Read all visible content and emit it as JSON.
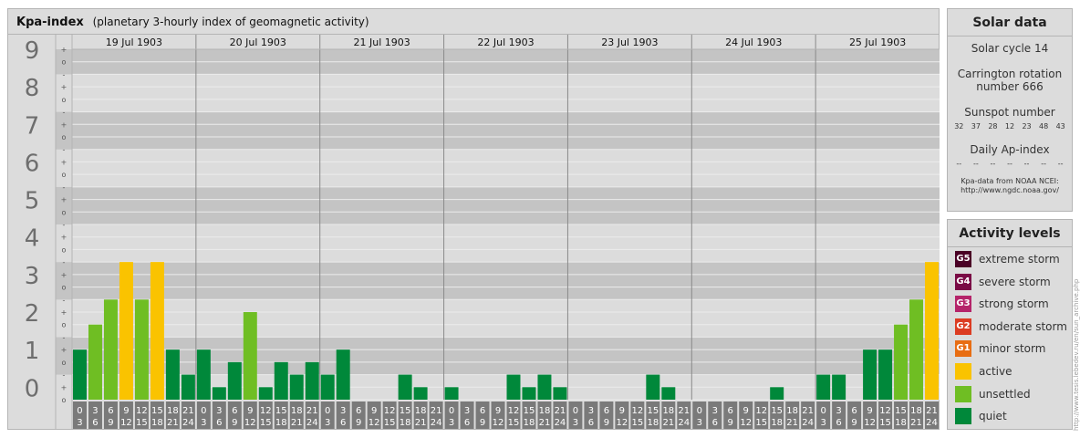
{
  "header": {
    "title": "Kpa-index",
    "subtitle": "(planetary 3-hourly index of geomagnetic activity)"
  },
  "chart_data": {
    "type": "bar",
    "ylim": [
      0,
      9
    ],
    "y_major_labels": [
      "0",
      "1",
      "2",
      "3",
      "4",
      "5",
      "6",
      "7",
      "8",
      "9"
    ],
    "y_minor_labels": [
      "o",
      "+",
      "-"
    ],
    "days": [
      "19 Jul 1903",
      "20 Jul 1903",
      "21 Jul 1903",
      "22 Jul 1903",
      "23 Jul 1903",
      "24 Jul 1903",
      "25 Jul 1903"
    ],
    "slot_labels": [
      [
        "0",
        "3"
      ],
      [
        "3",
        "6"
      ],
      [
        "6",
        "9"
      ],
      [
        "9",
        "12"
      ],
      [
        "12",
        "15"
      ],
      [
        "15",
        "18"
      ],
      [
        "18",
        "21"
      ],
      [
        "21",
        "24"
      ]
    ],
    "values": [
      1.333,
      2,
      2.667,
      3.667,
      2.667,
      3.667,
      1.333,
      0.667,
      1.333,
      0.333,
      1,
      2.333,
      0.333,
      1,
      0.667,
      1,
      0.667,
      1.333,
      0,
      0,
      0,
      0.667,
      0.333,
      0,
      0.333,
      0,
      0,
      0,
      0.667,
      0.333,
      0.667,
      0.333,
      0,
      0,
      0,
      0,
      0,
      0.667,
      0.333,
      0,
      0,
      0,
      0,
      0,
      0,
      0.333,
      0,
      0,
      0.667,
      0.667,
      0,
      1.333,
      1.333,
      2,
      2.667,
      3.667
    ],
    "colors": {
      "quiet": "#00883a",
      "unsettled": "#6fbe23",
      "active": "#fac300"
    },
    "grid": true
  },
  "solar": {
    "title": "Solar data",
    "cycle": "Solar cycle 14",
    "carrington_line1": "Carrington rotation",
    "carrington_line2": "number 666",
    "sunspot_label": "Sunspot number",
    "sunspot_values": [
      "32",
      "37",
      "28",
      "12",
      "23",
      "48",
      "43"
    ],
    "ap_label": "Daily Ap-index",
    "ap_values": [
      "--",
      "--",
      "--",
      "--",
      "--",
      "--",
      "--"
    ],
    "source_line1": "Kpa-data from NOAA NCEI:",
    "source_line2": "http://www.ngdc.noaa.gov/"
  },
  "activity": {
    "title": "Activity levels",
    "levels": [
      {
        "code": "G5",
        "label": "extreme storm",
        "color": "#4a0025"
      },
      {
        "code": "G4",
        "label": "severe storm",
        "color": "#7a0a45"
      },
      {
        "code": "G3",
        "label": "strong storm",
        "color": "#b5246a"
      },
      {
        "code": "G2",
        "label": "moderate storm",
        "color": "#dc3c22"
      },
      {
        "code": "G1",
        "label": "minor storm",
        "color": "#e86d12"
      },
      {
        "code": "",
        "label": "active",
        "color": "#fac300"
      },
      {
        "code": "",
        "label": "unsettled",
        "color": "#6fbe23"
      },
      {
        "code": "",
        "label": "quiet",
        "color": "#00883a"
      }
    ]
  },
  "watermark": "http://www.tesis.lebedev.ru/en/sun_archive.php"
}
